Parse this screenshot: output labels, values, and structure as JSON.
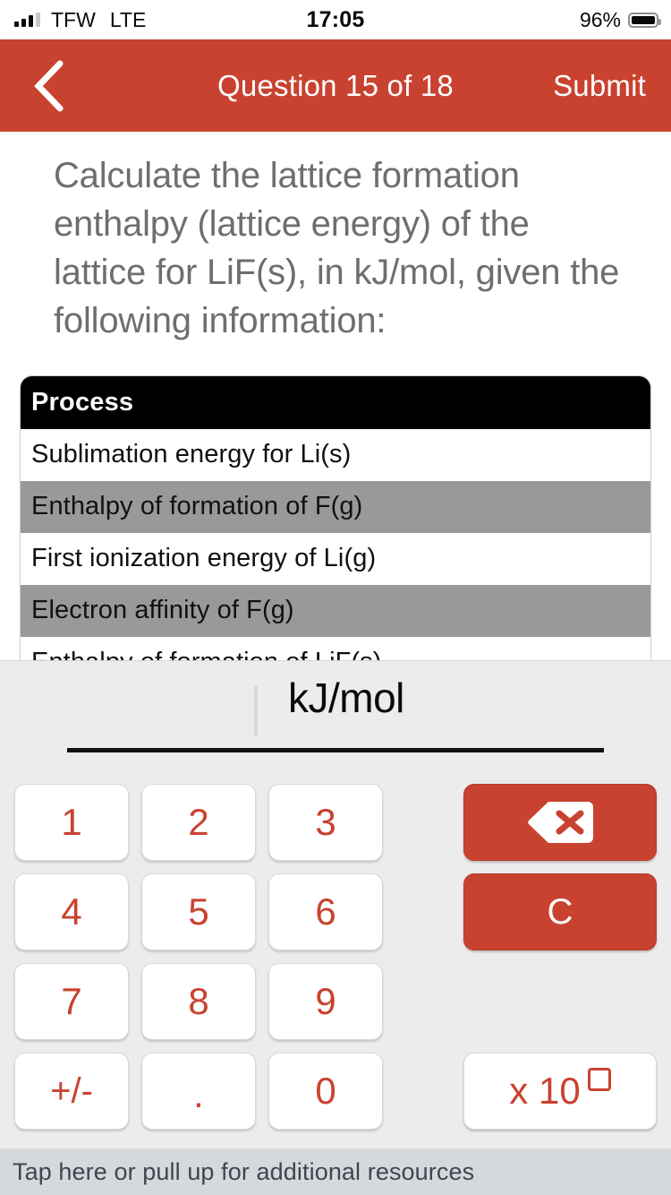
{
  "status_bar": {
    "carrier": "TFW",
    "network": "LTE",
    "time": "17:05",
    "battery_percent": "96%",
    "signal_bars_filled": 3,
    "signal_bars_total": 4
  },
  "nav": {
    "back_icon": "chevron-left-icon",
    "title": "Question 15 of 18",
    "submit_label": "Submit",
    "accent_color": "#c9422f"
  },
  "question": {
    "text": "Calculate the lattice formation enthalpy (lattice energy) of the lattice for LiF(s), in kJ/mol, given the following information:"
  },
  "table": {
    "header": "Process",
    "rows": [
      "Sublimation energy for Li(s)",
      "Enthalpy of formation of F(g)",
      "First ionization energy of Li(g)",
      "Electron affinity of F(g)",
      "Enthalpy of formation of LiF(s)"
    ]
  },
  "answer": {
    "value": "",
    "unit": "kJ/mol"
  },
  "keypad": {
    "keys": [
      "1",
      "2",
      "3",
      "4",
      "5",
      "6",
      "7",
      "8",
      "9",
      "+/-",
      ".",
      "0"
    ],
    "backspace_icon": "backspace-icon",
    "clear_label": "C",
    "exponent_label": "x 10",
    "exponent_placeholder": "□"
  },
  "footer": {
    "text": "Tap here or pull up for additional resources"
  }
}
